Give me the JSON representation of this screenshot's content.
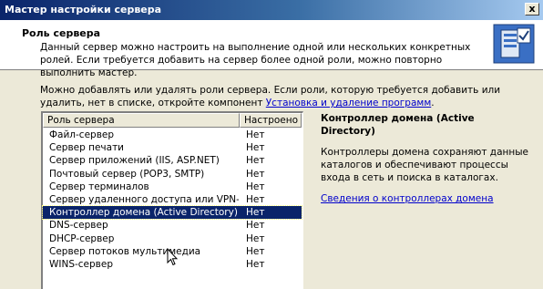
{
  "window": {
    "title": "Мастер настройки сервера",
    "close_label": "x"
  },
  "header": {
    "title": "Роль сервера",
    "description": "Данный сервер можно настроить на выполнение одной или нескольких конкретных ролей. Если требуется добавить на сервер более одной роли, можно повторно выполнить мастер."
  },
  "intro": {
    "text": "Можно добавлять или удалять роли сервера. Если роли, которую требуется добавить или удалить, нет в списке, откройте компонент ",
    "link": "Установка и удаление программ",
    "suffix": "."
  },
  "role_table": {
    "columns": [
      "Роль сервера",
      "Настроено"
    ],
    "rows": [
      {
        "name": "Файл-сервер",
        "configured": "Нет"
      },
      {
        "name": "Сервер печати",
        "configured": "Нет"
      },
      {
        "name": "Сервер приложений (IIS, ASP.NET)",
        "configured": "Нет"
      },
      {
        "name": "Почтовый сервер (POP3, SMTP)",
        "configured": "Нет"
      },
      {
        "name": "Сервер терминалов",
        "configured": "Нет"
      },
      {
        "name": "Сервер удаленного доступа или VPN-с...",
        "configured": "Нет"
      },
      {
        "name": "Контроллер домена (Active Directory)",
        "configured": "Нет",
        "selected": true
      },
      {
        "name": "DNS-сервер",
        "configured": "Нет"
      },
      {
        "name": "DHCP-сервер",
        "configured": "Нет"
      },
      {
        "name": "Сервер потоков мультимедиа",
        "configured": "Нет"
      },
      {
        "name": "WINS-сервер",
        "configured": "Нет"
      }
    ]
  },
  "details": {
    "title": "Контроллер домена (Active Directory)",
    "description": "Контроллеры домена сохраняют данные каталогов и обеспечивают процессы входа в сеть и поиска в каталогах.",
    "link": "Сведения о контроллерах домена"
  },
  "icons": {
    "wizard": "server-wizard-icon",
    "cursor": "mouse-pointer-icon",
    "close": "close-icon"
  },
  "colors": {
    "selection": "#0a246a",
    "link": "#0000cc",
    "titlebar": "#0a246a"
  }
}
